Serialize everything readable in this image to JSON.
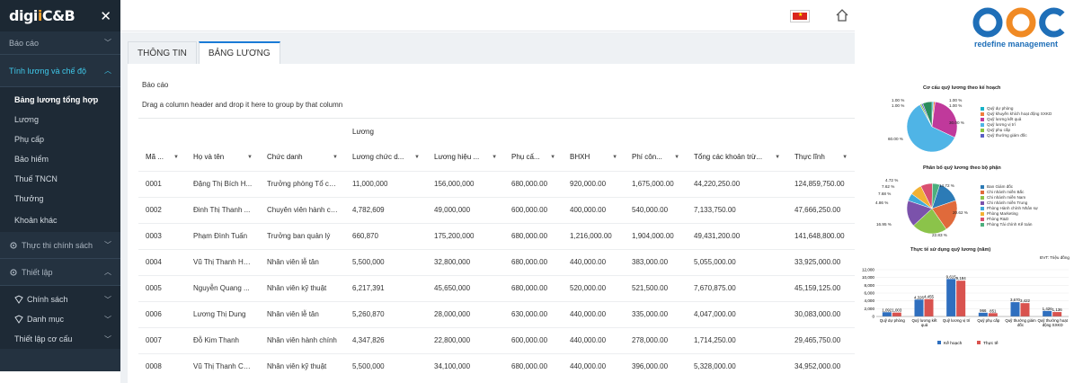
{
  "sidebar": {
    "logo_prefix": "digi",
    "logo_accent": "i",
    "logo_suffix": "C&B",
    "items": [
      {
        "label": "Báo cáo"
      },
      {
        "label": "Tính lương và chế độ"
      },
      {
        "label": "Bảng lương tổng hợp"
      },
      {
        "label": "Lương"
      },
      {
        "label": "Phụ cấp"
      },
      {
        "label": "Bảo hiểm"
      },
      {
        "label": "Thuế TNCN"
      },
      {
        "label": "Thưởng"
      },
      {
        "label": "Khoản khác"
      },
      {
        "label": "Thực thi chính sách"
      },
      {
        "label": "Thiết lập"
      },
      {
        "label": "Chính sách"
      },
      {
        "label": "Danh mục"
      },
      {
        "label": "Thiết lập cơ cấu"
      }
    ]
  },
  "tabs": [
    {
      "label": "THÔNG TIN"
    },
    {
      "label": "BẢNG LƯƠNG"
    }
  ],
  "breadcrumb": "Báo cáo",
  "group_hint": "Drag a column header and drop it here to group by that column",
  "table": {
    "group_header": "Lương",
    "columns": [
      "Mã ...",
      "Họ và tên",
      "Chức danh",
      "Lương chức d...",
      "Lương hiệu ...",
      "Phụ cấ...",
      "BHXH",
      "Phí côn...",
      "Tổng các khoản trừ...",
      "Thực lĩnh"
    ],
    "rows": [
      [
        "0001",
        "Đặng Thị Bích H...",
        "Trưởng phòng Tổ ch...",
        "11,000,000",
        "156,000,000",
        "680,000.00",
        "920,000.00",
        "1,675,000.00",
        "44,220,250.00",
        "124,859,750.00"
      ],
      [
        "0002",
        "Đinh Thị Thanh ...",
        "Chuyên viên hành ch...",
        "4,782,609",
        "49,000,000",
        "600,000.00",
        "400,000.00",
        "540,000.00",
        "7,133,750.00",
        "47,666,250.00"
      ],
      [
        "0003",
        "Phạm Đình Tuấn",
        "Trưởng ban quản lý",
        "660,870",
        "175,200,000",
        "680,000.00",
        "1,216,000.00",
        "1,904,000.00",
        "49,431,200.00",
        "141,648,800.00"
      ],
      [
        "0004",
        "Vũ Thị Thanh Hằ...",
        "Nhân viên lễ tân",
        "5,500,000",
        "32,800,000",
        "680,000.00",
        "440,000.00",
        "383,000.00",
        "5,055,000.00",
        "33,925,000.00"
      ],
      [
        "0005",
        "Nguyễn Quang ...",
        "Nhân viên kỹ thuật",
        "6,217,391",
        "45,650,000",
        "680,000.00",
        "520,000.00",
        "521,500.00",
        "7,670,875.00",
        "45,159,125.00"
      ],
      [
        "0006",
        "Lương Thị Dung",
        "Nhân viên lễ tân",
        "5,260,870",
        "28,000,000",
        "630,000.00",
        "440,000.00",
        "335,000.00",
        "4,047,000.00",
        "30,083,000.00"
      ],
      [
        "0007",
        "Đỗ Kim Thanh",
        "Nhân viên hành chính",
        "4,347,826",
        "22,800,000",
        "600,000.00",
        "440,000.00",
        "278,000.00",
        "1,714,250.00",
        "29,465,750.00"
      ],
      [
        "0008",
        "Vũ Thị Thanh Ch...",
        "Nhân viên kỹ thuật",
        "5,500,000",
        "34,100,000",
        "680,000.00",
        "440,000.00",
        "396,000.00",
        "5,328,000.00",
        "34,952,000.00"
      ]
    ]
  },
  "brand": {
    "name": "OCC",
    "tagline": "redefine management"
  },
  "chart_data": [
    {
      "type": "pie",
      "title": "Cơ cấu quỹ lương theo kế hoạch",
      "series": [
        {
          "values": [
            1.0,
            1.0,
            30.0,
            60.0,
            1.0,
            1.0,
            6.0
          ]
        }
      ],
      "categories": [
        "Quỹ dự phòng",
        "Quỹ khuyến khích hoạt động SXKD",
        "Quỹ lương kết quả",
        "Quỹ lương vị trí",
        "Quỹ phụ cấp",
        "Quỹ thưởng giám đốc",
        ""
      ],
      "labels": [
        "1.00 %",
        "1.00 %",
        "30.00 %",
        "60.00 %",
        "1.00 %",
        "1.00 %"
      ],
      "colors": [
        "#17b3c8",
        "#f07c3c",
        "#c0399b",
        "#4fb4e6",
        "#8bc63f",
        "#5a5fc4",
        "#2a8c5c"
      ]
    },
    {
      "type": "pie",
      "title": "Phân bổ quỹ lương theo bộ phận",
      "series": [
        {
          "values": [
            14.72,
            20.62,
            22.83,
            16.95,
            4.86,
            7.68,
            7.62,
            4.72
          ]
        }
      ],
      "categories": [
        "Ban Giám đốc",
        "Chi nhánh miền Bắc",
        "Chi nhánh miền Nam",
        "Chi nhánh miền Trung",
        "Phòng Hành chính Nhân sự",
        "Phòng Marketing",
        "Phòng R&D",
        "Phòng Tài chính Kế toán"
      ],
      "labels": [
        "14.72 %",
        "20.62 %",
        "22.83 %",
        "16.95 %",
        "4.86 %",
        "7.68 %",
        "7.62 %",
        "4.72 %"
      ],
      "colors": [
        "#2c7bb6",
        "#e06a3b",
        "#8bc34a",
        "#7b52ab",
        "#3fa9d9",
        "#f2b134",
        "#d94f70",
        "#4caf7d"
      ]
    },
    {
      "type": "bar",
      "title": "Thực tế sử dụng quỹ lương (năm)",
      "unit_note": "ĐVT: Triệu đồng",
      "categories": [
        "Quỹ dự phòng",
        "Quỹ lương kết quả",
        "Quỹ lương vị trí",
        "Quỹ phụ cấp",
        "Quỹ thưởng giám đốc",
        "Quỹ thưởng hoạt động SXKD"
      ],
      "series": [
        {
          "name": "Kế hoạch",
          "values": [
            1092,
            4326,
            9615,
            966,
            3670,
            1426
          ],
          "labels": [
            "1,092",
            "4,326",
            "9,615",
            "966",
            "3,670",
            "1,426"
          ]
        },
        {
          "name": "Thực tế",
          "values": [
            1003,
            4455,
            9184,
            851,
            3422,
            1136
          ],
          "labels": [
            "1,003",
            "4,455",
            "9,184",
            "851",
            "3,422",
            "1,136"
          ]
        }
      ],
      "yticks": [
        "12,000",
        "10,000",
        "8,000",
        "6,000",
        "4,000",
        "2,000",
        "0"
      ],
      "ylim": [
        0,
        12000
      ],
      "colors": [
        "#2f6fbf",
        "#d9534f"
      ]
    }
  ]
}
